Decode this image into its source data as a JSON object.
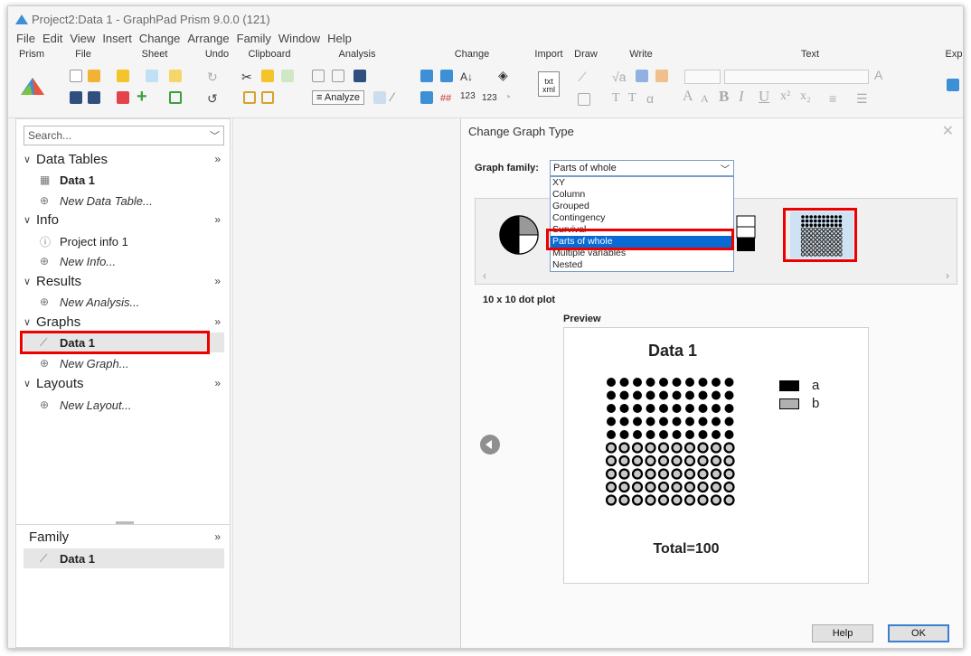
{
  "window": {
    "title": "Project2:Data 1 - GraphPad Prism 9.0.0 (121)"
  },
  "menu": [
    "File",
    "Edit",
    "View",
    "Insert",
    "Change",
    "Arrange",
    "Family",
    "Window",
    "Help"
  ],
  "ribbon": {
    "groups": [
      {
        "label": "Prism"
      },
      {
        "label": "File"
      },
      {
        "label": "Sheet"
      },
      {
        "label": "Undo"
      },
      {
        "label": "Clipboard"
      },
      {
        "label": "Analysis"
      },
      {
        "label": "Change"
      },
      {
        "label": "Import"
      },
      {
        "label": "Draw"
      },
      {
        "label": "Write"
      },
      {
        "label": "Text"
      },
      {
        "label": "Exp"
      }
    ],
    "analyze_label": "Analyze",
    "font_labels": {
      "grow": "A",
      "shrink": "A",
      "bold": "B",
      "italic": "I",
      "underline": "U"
    },
    "write_labels": {
      "txt": "txt",
      "xml": "xml"
    }
  },
  "sidebar": {
    "search_placeholder": "Search...",
    "sections": [
      {
        "label": "Data Tables",
        "items": [
          {
            "label": "Data 1"
          }
        ],
        "new": "New Data Table..."
      },
      {
        "label": "Info",
        "items": [
          {
            "label": "Project info 1"
          }
        ],
        "new": "New Info..."
      },
      {
        "label": "Results",
        "items": [],
        "new": "New Analysis..."
      },
      {
        "label": "Graphs",
        "items": [
          {
            "label": "Data 1"
          }
        ],
        "new": "New Graph..."
      },
      {
        "label": "Layouts",
        "items": [],
        "new": "New Layout..."
      }
    ],
    "more": "»",
    "family": {
      "label": "Family",
      "items": [
        {
          "label": "Data 1"
        }
      ]
    }
  },
  "dialog": {
    "title": "Change Graph Type",
    "close": "✕",
    "graph_family_label": "Graph family:",
    "selected_family": "Parts of whole",
    "family_options": [
      "XY",
      "Column",
      "Grouped",
      "Contingency",
      "Survival",
      "Parts of whole",
      "Multiple variables",
      "Nested"
    ],
    "selected_type_caption": "10 x 10 dot plot",
    "preview_label": "Preview",
    "preview": {
      "title": "Data 1",
      "total": "Total=100",
      "legend": [
        {
          "name": "a",
          "color": "#000000"
        },
        {
          "name": "b",
          "color": "#b0b0b0"
        }
      ]
    },
    "buttons": {
      "help": "Help",
      "ok": "OK"
    }
  },
  "colors": {
    "highlight": "#e00000",
    "selection": "#0a6ad4"
  }
}
